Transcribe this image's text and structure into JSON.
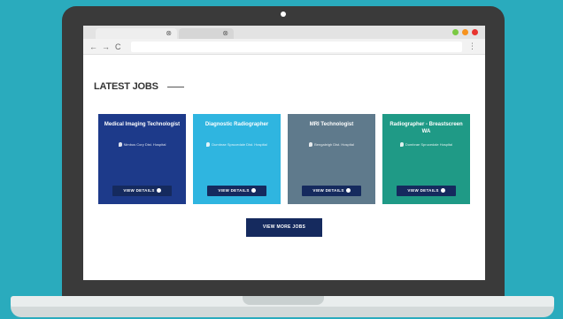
{
  "browser": {
    "tabs": [
      {
        "close": "⊗"
      },
      {
        "close": "⊗"
      }
    ],
    "window_dots": [
      "#7ac943",
      "#f7931e",
      "#e8332e"
    ],
    "nav": {
      "back": "←",
      "forward": "→",
      "reload": "C"
    },
    "menu": "⋮"
  },
  "page": {
    "heading": "LATEST JOBS",
    "cards": [
      {
        "title": "Medical Imaging Technologist",
        "location": "Nimbus Cory Dist. Hospital",
        "button": "VIEW DETAILS",
        "color": "#1d3a8a"
      },
      {
        "title": "Diagnostic Radiographer",
        "location": "Dumbrae Sprucedale Dist. Hospital",
        "button": "VIEW DETAILS",
        "color": "#2fb5e0"
      },
      {
        "title": "MRI Technologist",
        "location": "Bengaleigh Dist. Hospital",
        "button": "VIEW DETAILS",
        "color": "#5f7a8c"
      },
      {
        "title": "Radiographer - Breastscreen WA",
        "location": "Dumbrae Sprucedale Hospital",
        "button": "VIEW DETAILS",
        "color": "#1f9a86"
      }
    ],
    "more_button": "VIEW MORE JOBS"
  },
  "colors": {
    "background": "#2aabbd",
    "button_bg": "#152a5e",
    "laptop": "#3a3a3a"
  }
}
